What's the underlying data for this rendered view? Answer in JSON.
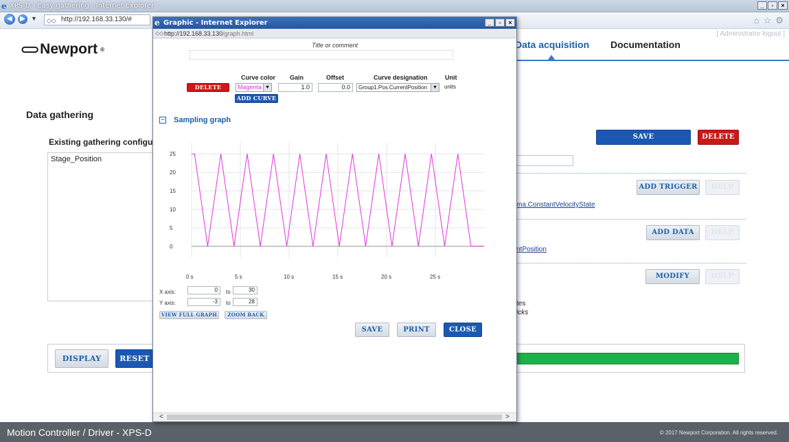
{
  "main_window": {
    "title": "XPS-D - Easy gathering - Internet Explorer",
    "url": "http://192.168.33.130/#",
    "admin_logout": "[ Administrator logout ]"
  },
  "brand": {
    "name": "Newport",
    "mark": "∞"
  },
  "nav": {
    "data_acquisition": "Data acquisition",
    "documentation": "Documentation"
  },
  "page": {
    "heading": "Data gathering",
    "existing_configs_label": "Existing gathering configu",
    "configs": [
      "Stage_Position"
    ],
    "save_configuration": "SAVE CONFIGURATION",
    "delete": "DELETE",
    "add_trigger": "ADD TRIGGER",
    "add_data": "ADD DATA",
    "modify": "MODIFY",
    "help": "HELP",
    "trigger_text": "ma.ConstantVelocityState",
    "data_text": "ntPosition",
    "note1": "tes",
    "note2": "icks",
    "display": "DISPLAY",
    "reset": "RESET",
    "progress": 1.0
  },
  "footer": {
    "left": "Motion Controller / Driver - XPS-D",
    "right": "© 2017 Newport Corporation. All rights reserved."
  },
  "popup": {
    "title": "Graphic - Internet Explorer",
    "url_host": "http://192.168.33.130",
    "url_path": "/graph.html",
    "title_label": "Title or comment",
    "headers": {
      "curve_color": "Curve color",
      "gain": "Gain",
      "offset": "Offset",
      "curve_designation": "Curve designation",
      "unit": "Unit"
    },
    "delete": "DELETE",
    "add_curve": "ADD CURVE",
    "curve_color": "Magenta",
    "gain": "1.0",
    "offset": "0.0",
    "curve_designation": "Group1.Pos.CurrentPosition",
    "unit": "units",
    "section_title": "Sampling graph",
    "x_axis_label": "X axis:",
    "y_axis_label": "Y axis:",
    "to": "to",
    "x_from": "0",
    "x_to": "30",
    "y_from": "-3",
    "y_to": "28",
    "view_full_graph": "VIEW FULL GRAPH",
    "zoom_back": "ZOOM BACK",
    "save": "SAVE",
    "print": "PRINT",
    "close": "CLOSE"
  },
  "chart_data": {
    "type": "line",
    "x_ticks": [
      "0 s",
      "5 s",
      "10 s",
      "15 s",
      "20 s",
      "25 s"
    ],
    "y_ticks": [
      "0",
      "5",
      "10",
      "15",
      "20",
      "25"
    ],
    "xlim": [
      0,
      30
    ],
    "ylim": [
      -3,
      28
    ],
    "grid": true,
    "series": [
      {
        "color": "#e033e0",
        "x": [
          0,
          0.3,
          1.65,
          3.0,
          4.35,
          5.7,
          7.05,
          8.4,
          9.75,
          11.1,
          12.45,
          13.8,
          15.15,
          16.5,
          17.85,
          19.2,
          20.55,
          21.9,
          23.25,
          24.6,
          25.95,
          27.3,
          28.65,
          30.0
        ],
        "y": [
          25,
          25,
          0,
          25,
          0,
          25,
          0,
          25,
          0,
          25,
          0,
          25,
          0,
          25,
          0,
          25,
          0,
          25,
          0,
          25,
          0,
          25,
          0,
          0
        ]
      }
    ]
  }
}
